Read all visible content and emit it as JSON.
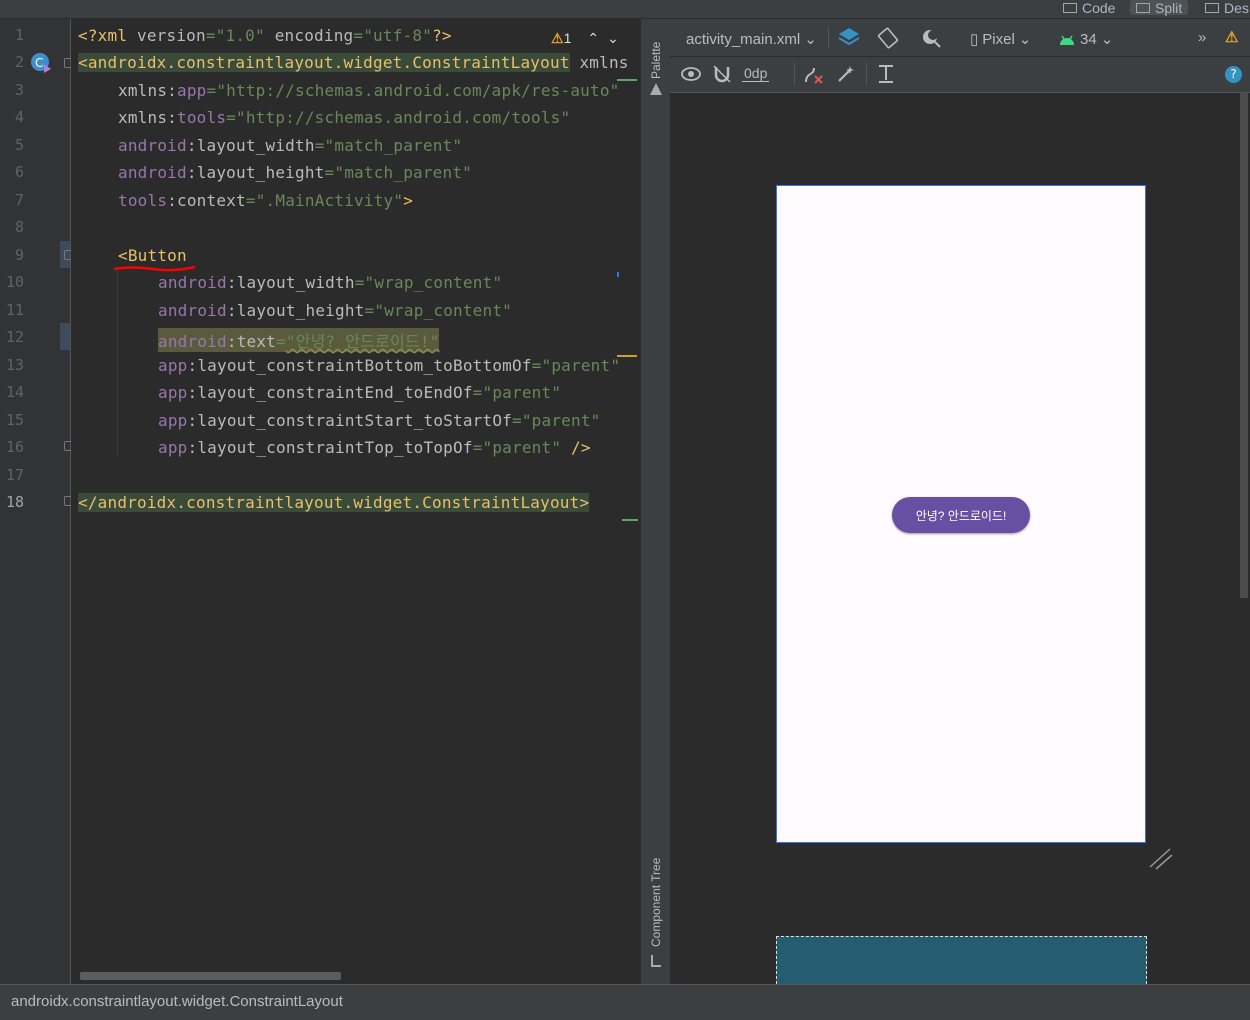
{
  "top_bar": {
    "modes": [
      "Code",
      "Split",
      "Des"
    ]
  },
  "gutter": {
    "line_numbers": [
      "1",
      "2",
      "3",
      "4",
      "5",
      "6",
      "7",
      "8",
      "9",
      "10",
      "11",
      "12",
      "13",
      "14",
      "15",
      "16",
      "17",
      "18"
    ]
  },
  "editor": {
    "warning_count": "1",
    "lines": {
      "l1": {
        "pi_open": "<?xml ",
        "k1": "version",
        "eq1": "=",
        "v1": "\"1.0\"",
        "sp": " ",
        "k2": "encoding",
        "eq2": "=",
        "v2": "\"utf-8\"",
        "pi_close": "?>"
      },
      "l2": {
        "tag": "<androidx.constraintlayout.widget.ConstraintLayout",
        "rest": " xmlns"
      },
      "l3": {
        "ns": "xmlns:",
        "attr": "app",
        "eq": "=",
        "val": "\"http://schemas.android.com/apk/res-auto\""
      },
      "l4": {
        "ns": "xmlns:",
        "attr": "tools",
        "eq": "=",
        "val": "\"http://schemas.android.com/tools\""
      },
      "l5": {
        "ns": "android",
        "colon": ":",
        "attr": "layout_width",
        "eq": "=",
        "val": "\"match_parent\""
      },
      "l6": {
        "ns": "android",
        "colon": ":",
        "attr": "layout_height",
        "eq": "=",
        "val": "\"match_parent\""
      },
      "l7": {
        "ns": "tools",
        "colon": ":",
        "attr": "context",
        "eq": "=",
        "val": "\".MainActivity\"",
        "close": ">"
      },
      "l9": {
        "tag": "<Button"
      },
      "l10": {
        "ns": "android",
        "colon": ":",
        "attr": "layout_width",
        "eq": "=",
        "val": "\"wrap_content\""
      },
      "l11": {
        "ns": "android",
        "colon": ":",
        "attr": "layout_height",
        "eq": "=",
        "val": "\"wrap_content\""
      },
      "l12": {
        "ns": "android",
        "colon": ":",
        "attr": "text",
        "eq": "=",
        "val": "\"안녕? 안드로이드!\""
      },
      "l13": {
        "ns": "app",
        "colon": ":",
        "attr": "layout_constraintBottom_toBottomOf",
        "eq": "=",
        "val": "\"parent\""
      },
      "l14": {
        "ns": "app",
        "colon": ":",
        "attr": "layout_constraintEnd_toEndOf",
        "eq": "=",
        "val": "\"parent\""
      },
      "l15": {
        "ns": "app",
        "colon": ":",
        "attr": "layout_constraintStart_toStartOf",
        "eq": "=",
        "val": "\"parent\""
      },
      "l16": {
        "ns": "app",
        "colon": ":",
        "attr": "layout_constraintTop_toTopOf",
        "eq": "=",
        "val": "\"parent\"",
        "close": " />"
      },
      "l18": {
        "tag": "</androidx.constraintlayout.widget.ConstraintLayout>"
      }
    }
  },
  "side_panel": {
    "palette": "Palette",
    "component_tree": "Component Tree"
  },
  "design_toolbar": {
    "file": "activity_main.xml",
    "device": "Pixel",
    "api": "34",
    "margin": "0dp"
  },
  "preview": {
    "button_text": "안녕? 안드로이드!",
    "button_color": "#6750a4",
    "screen_bg": "#fffbfe",
    "blueprint_color": "#255c70"
  },
  "status_bar": {
    "text": "androidx.constraintlayout.widget.ConstraintLayout"
  }
}
